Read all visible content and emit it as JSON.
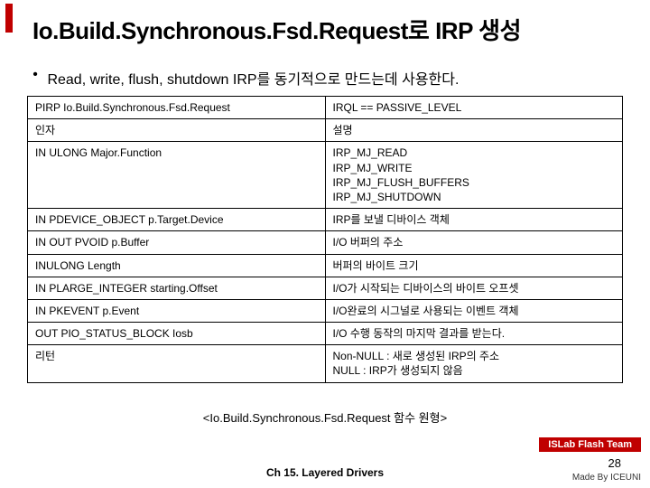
{
  "title": "Io.Build.Synchronous.Fsd.Request로 IRP 생성",
  "bullet": "Read, write, flush, shutdown IRP를 동기적으로 만드는데 사용한다.",
  "table": {
    "rows": [
      {
        "left": "PIRP Io.Build.Synchronous.Fsd.Request",
        "right": "IRQL == PASSIVE_LEVEL"
      },
      {
        "left": "인자",
        "right": "설명"
      },
      {
        "left": "IN ULONG Major.Function",
        "right": "IRP_MJ_READ\nIRP_MJ_WRITE\nIRP_MJ_FLUSH_BUFFERS\nIRP_MJ_SHUTDOWN"
      },
      {
        "left": "IN PDEVICE_OBJECT p.Target.Device",
        "right": "IRP를 보낼 디바이스 객체"
      },
      {
        "left": "IN OUT PVOID p.Buffer",
        "right": "I/O 버퍼의 주소"
      },
      {
        "left": "INULONG Length",
        "right": "버퍼의 바이트 크기"
      },
      {
        "left": "IN PLARGE_INTEGER starting.Offset",
        "right": "I/O가 시작되는 디바이스의 바이트 오프셋"
      },
      {
        "left": "IN PKEVENT p.Event",
        "right": "I/O완료의 시그널로 사용되는 이벤트 객체"
      },
      {
        "left": "OUT PIO_STATUS_BLOCK Iosb",
        "right": "I/O 수행 동작의 마지막 결과를 받는다."
      },
      {
        "left": "리턴",
        "right": "Non-NULL : 새로 생성된 IRP의 주소\nNULL : IRP가 생성되지 않음"
      }
    ]
  },
  "caption": "<Io.Build.Synchronous.Fsd.Request 함수 원형>",
  "footer": {
    "team": "ISLab Flash Team",
    "chapter": "Ch 15. Layered Drivers",
    "page": "28",
    "made": "Made By ICEUNI"
  }
}
